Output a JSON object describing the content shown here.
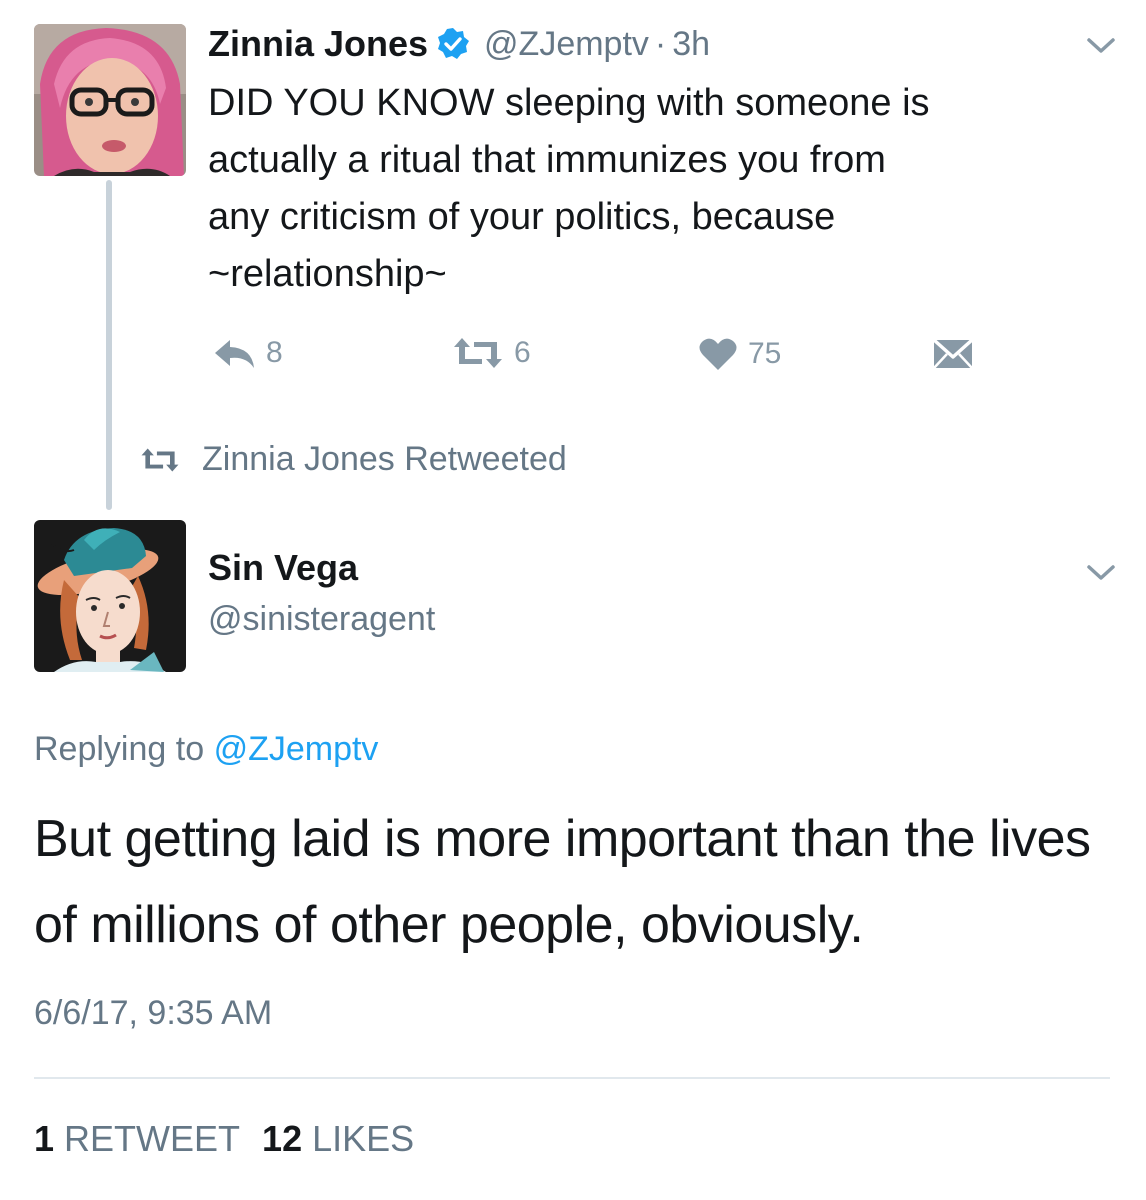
{
  "tweet1": {
    "name": "Zinnia Jones",
    "handle": "@ZJemptv",
    "separator": "·",
    "time": "3h",
    "text": "DID YOU KNOW sleeping with someone is\nactually a ritual that immunizes you from\nany criticism of your politics, because\n~relationship~",
    "actions": {
      "reply_count": "8",
      "retweet_count": "6",
      "like_count": "75"
    },
    "icons": [
      "verified-badge-icon",
      "chevron-down-icon",
      "reply-icon",
      "retweet-icon",
      "heart-icon",
      "message-icon"
    ]
  },
  "retweeted_label": "Zinnia Jones Retweeted",
  "tweet2": {
    "name": "Sin Vega",
    "handle": "@sinisteragent",
    "replying_prefix": "Replying to",
    "replying_to": "@ZJemptv",
    "text": "But getting laid is more important than the lives of millions of other people, obviously.",
    "timestamp": "6/6/17, 9:35 AM",
    "retweets_count": "1",
    "retweets_label": "RETWEET",
    "likes_count": "12",
    "likes_label": "LIKES"
  },
  "colors": {
    "text": "#14171a",
    "secondary": "#657786",
    "action": "#8899a6",
    "accent": "#1da1f2",
    "thread_line": "#c8d2da",
    "divider": "#e1e8ed"
  }
}
